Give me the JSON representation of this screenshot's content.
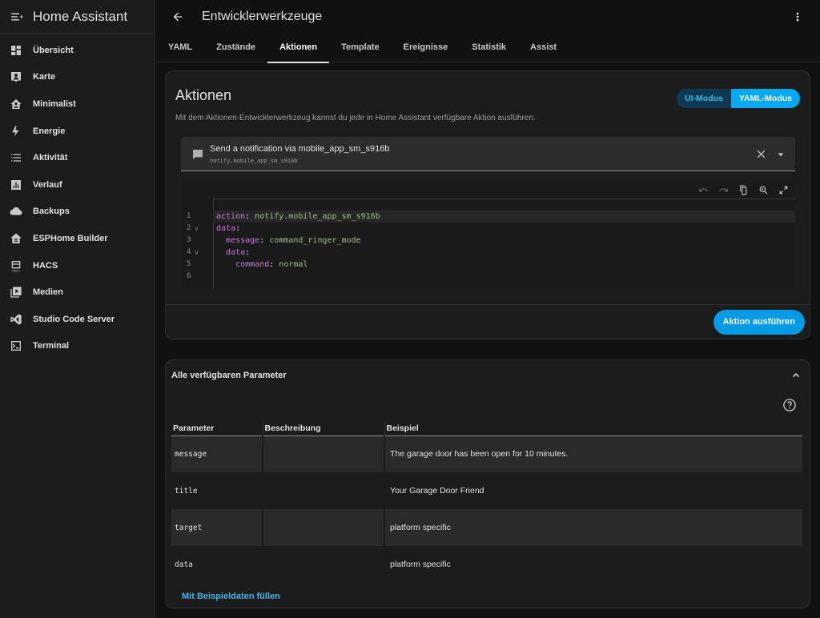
{
  "sidebar": {
    "title": "Home Assistant",
    "items": [
      {
        "label": "Übersicht",
        "icon": "dashboard-icon"
      },
      {
        "label": "Karte",
        "icon": "map-person-icon"
      },
      {
        "label": "Minimalist",
        "icon": "home-account-icon"
      },
      {
        "label": "Energie",
        "icon": "lightning-icon"
      },
      {
        "label": "Aktivität",
        "icon": "list-icon"
      },
      {
        "label": "Verlauf",
        "icon": "chart-box-icon"
      },
      {
        "label": "Backups",
        "icon": "cloud-icon"
      },
      {
        "label": "ESPHome Builder",
        "icon": "esphome-icon"
      },
      {
        "label": "HACS",
        "icon": "hacs-icon"
      },
      {
        "label": "Medien",
        "icon": "play-box-icon"
      },
      {
        "label": "Studio Code Server",
        "icon": "vscode-icon"
      },
      {
        "label": "Terminal",
        "icon": "console-icon"
      }
    ]
  },
  "topbar": {
    "title": "Entwicklerwerkzeuge"
  },
  "tabs": [
    {
      "label": "YAML",
      "active": false
    },
    {
      "label": "Zustände",
      "active": false
    },
    {
      "label": "Aktionen",
      "active": true
    },
    {
      "label": "Template",
      "active": false
    },
    {
      "label": "Ereignisse",
      "active": false
    },
    {
      "label": "Statistik",
      "active": false
    },
    {
      "label": "Assist",
      "active": false
    }
  ],
  "actions_card": {
    "title": "Aktionen",
    "description": "Mit dem Aktionen-Entwicklerwerkzeug kannst du jede in Home Assistant verfügbare Aktion ausführen.",
    "mode_ui": "UI-Modus",
    "mode_yaml": "YAML-Modus",
    "selected_action": {
      "title": "Send a notification via mobile_app_sm_s916b",
      "id": "notify.mobile_app_sm_s916b"
    },
    "editor_lines": [
      {
        "num": "1",
        "fold": "",
        "indent": "",
        "key": "action",
        "value": "notify.mobile_app_sm_s916b"
      },
      {
        "num": "2",
        "fold": "v",
        "indent": "",
        "key": "data",
        "value": ""
      },
      {
        "num": "3",
        "fold": "",
        "indent": "  ",
        "key": "message",
        "value": "command_ringer_mode"
      },
      {
        "num": "4",
        "fold": "v",
        "indent": "  ",
        "key": "data",
        "value": ""
      },
      {
        "num": "5",
        "fold": "",
        "indent": "    ",
        "key": "command",
        "value": "normal"
      },
      {
        "num": "6",
        "fold": "",
        "indent": "",
        "key": "",
        "value": ""
      }
    ],
    "run_button": "Aktion ausführen"
  },
  "params_card": {
    "title": "Alle verfügbaren Parameter",
    "headers": [
      "Parameter",
      "Beschreibung",
      "Beispiel"
    ],
    "rows": [
      {
        "name": "message",
        "description": "",
        "example": "The garage door has been open for 10 minutes."
      },
      {
        "name": "title",
        "description": "",
        "example": "Your Garage Door Friend"
      },
      {
        "name": "target",
        "description": "",
        "example": "platform specific"
      },
      {
        "name": "data",
        "description": "",
        "example": "platform specific"
      }
    ],
    "fill_link": "Mit Beispieldaten füllen"
  },
  "colors": {
    "accent": "#03a9f4",
    "background": "#111111",
    "card": "#1c1c1c"
  }
}
